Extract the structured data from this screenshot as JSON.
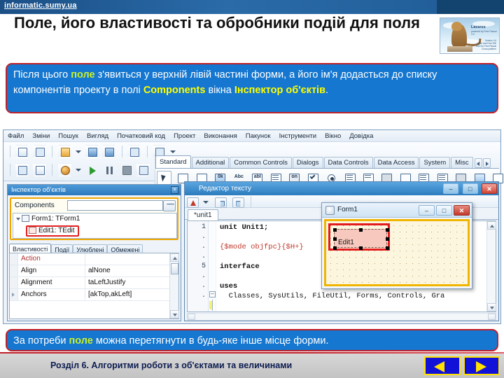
{
  "banner": {
    "url": "informatic.sumy.ua"
  },
  "slide": {
    "title": "Поле, його властивості та обробники подій для поля",
    "logo_brand": "Lazarus",
    "logo_brand_sub": "powered by Free Pascal 3.0",
    "logo_lines": [
      "Version 1.6",
      "Open and Free IDE",
      "RAD for Free Pascal",
      "Cross-platform"
    ]
  },
  "callout_top": {
    "parts": [
      {
        "text": "Після цього ",
        "style": "plain"
      },
      {
        "text": "поле",
        "style": "yellowgreen"
      },
      {
        "text": " з'явиться у верхній лівій частині форми, а його ім'я додасться до списку компонентів проекту в полі ",
        "style": "plain"
      },
      {
        "text": "Components",
        "style": "yellow"
      },
      {
        "text": " вікна ",
        "style": "plain"
      },
      {
        "text": "Інспектор об'єктів",
        "style": "yellow"
      },
      {
        "text": ".",
        "style": "plain"
      }
    ]
  },
  "callout_bottom": {
    "parts": [
      {
        "text": "За потреби ",
        "style": "plain"
      },
      {
        "text": "поле",
        "style": "yellowgreen"
      },
      {
        "text": " можна перетягнути в будь-яке інше місце форми.",
        "style": "plain"
      }
    ]
  },
  "ide": {
    "menu": [
      "Файл",
      "Зміни",
      "Пошук",
      "Вигляд",
      "Початковий код",
      "Проект",
      "Виконання",
      "Пакунок",
      "Інструменти",
      "Вікно",
      "Довідка"
    ],
    "palette_tabs": [
      "Standard",
      "Additional",
      "Common Controls",
      "Dialogs",
      "Data Controls",
      "Data Access",
      "System",
      "Misc"
    ],
    "palette_active_tab": "Standard",
    "palette_icon_labels": [
      "0k",
      "Abc",
      "abI",
      "on"
    ]
  },
  "object_inspector": {
    "title": "Інспектор об'єктів",
    "close_label": "×",
    "components_label": "Components",
    "components_value": "",
    "tree": {
      "root": "Form1: TForm1",
      "child": "Edit1: TEdit"
    },
    "tabs": [
      "Властивості",
      "Події",
      "Улюблені",
      "Обмежені"
    ],
    "active_tab": "Властивості",
    "properties": [
      {
        "name": "Action",
        "value": "",
        "red": true,
        "expandable": false
      },
      {
        "name": "Align",
        "value": "alNone",
        "red": false,
        "expandable": false
      },
      {
        "name": "Alignment",
        "value": "taLeftJustify",
        "red": false,
        "expandable": false
      },
      {
        "name": "Anchors",
        "value": "[akTop,akLeft]",
        "red": false,
        "expandable": true
      }
    ]
  },
  "editor": {
    "title": "Редактор тексту",
    "min_label": "–",
    "max_label": "□",
    "close_label": "✕",
    "tab": "*unit1",
    "lines": [
      {
        "num": "1",
        "text": "unit Unit1;",
        "style": "bold"
      },
      {
        "num": ".",
        "text": "",
        "style": "plain"
      },
      {
        "num": ".",
        "text": "{$mode objfpc}{$H+}",
        "style": "red"
      },
      {
        "num": ".",
        "text": "",
        "style": "plain"
      },
      {
        "num": "5",
        "text": "interface",
        "style": "bold"
      },
      {
        "num": ".",
        "text": "",
        "style": "plain"
      },
      {
        "num": ".",
        "text": "uses",
        "style": "bold"
      },
      {
        "num": ".",
        "text": "  Classes, SysUtils, FileUtil, Forms, Controls, Gra",
        "style": "plain"
      }
    ]
  },
  "form_window": {
    "title": "Form1",
    "min_label": "–",
    "max_label": "□",
    "close_label": "✕",
    "control_label": "Edit1"
  },
  "footer": {
    "text": "Розділ 6. Алгоритми роботи з об'єктами та величинами",
    "prev_label": "◀",
    "next_label": "▶"
  },
  "colors": {
    "callout_bg": "#1577d0",
    "callout_border": "#c02028",
    "highlight_green": "#c9f02a",
    "highlight_yellow": "#ffff00",
    "nav_blue": "#1111d8",
    "nav_yellow": "#ffe000",
    "selection_red": "#e21c1c",
    "selection_orange": "#f0b500"
  }
}
